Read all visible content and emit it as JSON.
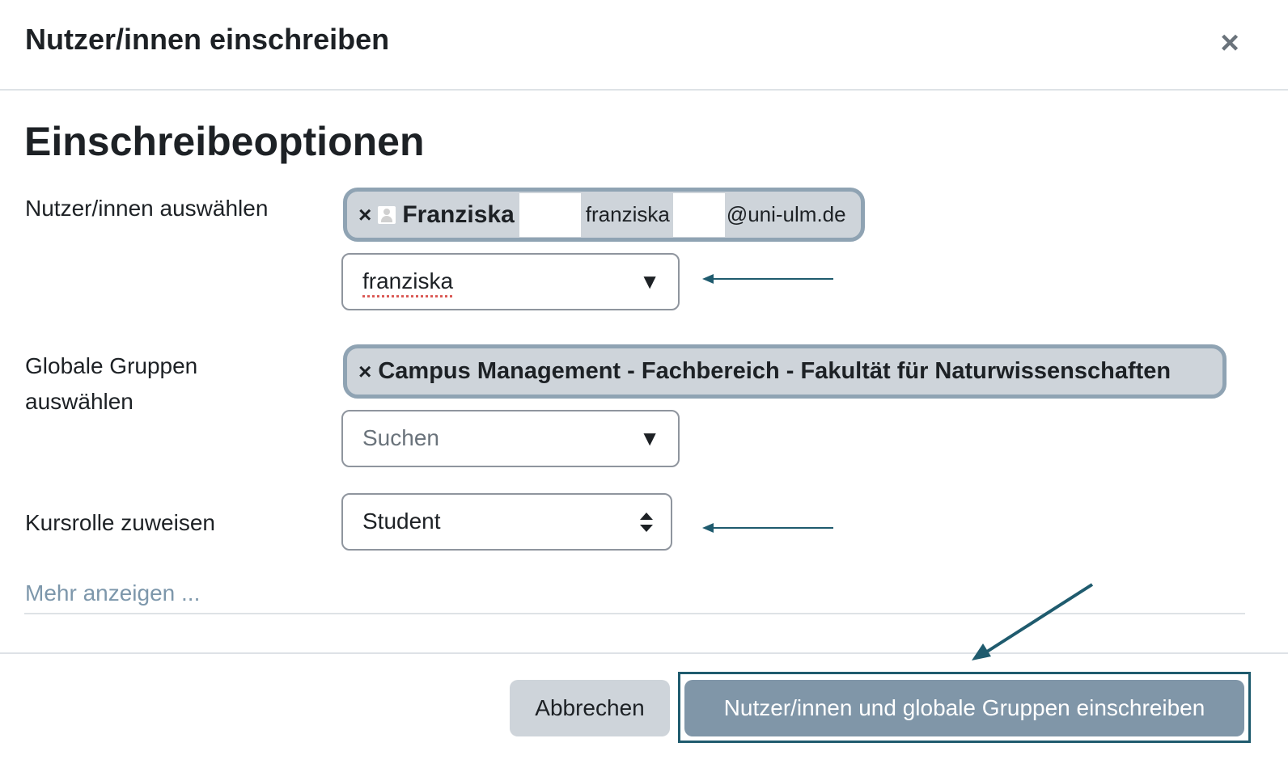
{
  "dialog": {
    "title": "Nutzer/innen einschreiben",
    "close_icon": "close-icon",
    "section_title": "Einschreibeoptionen"
  },
  "users": {
    "label": "Nutzer/innen auswählen",
    "chip": {
      "remove_icon": "×",
      "avatar_icon": "user-icon",
      "name": "Franziska",
      "email_prefix": "franziska",
      "email_domain": "@uni-ulm.de"
    },
    "search_value": "franziska",
    "dropdown_icon": "▼"
  },
  "groups": {
    "label": "Globale Gruppen auswählen",
    "chip": {
      "remove_icon": "×",
      "name": "Campus Management - Fachbereich - Fakultät für Naturwissenschaften"
    },
    "search_placeholder": "Suchen",
    "dropdown_icon": "▼"
  },
  "role": {
    "label": "Kursrolle zuweisen",
    "selected": "Student"
  },
  "more_link": "Mehr anzeigen ...",
  "footer": {
    "cancel_label": "Abbrechen",
    "submit_label": "Nutzer/innen und globale Gruppen einschreiben"
  },
  "colors": {
    "text": "#1d2125",
    "chip_bg": "#ced4da",
    "chip_border": "#8fa3b3",
    "primary_button": "#8096a8",
    "link": "#7d97ab",
    "annotation": "#1f5b6e"
  }
}
